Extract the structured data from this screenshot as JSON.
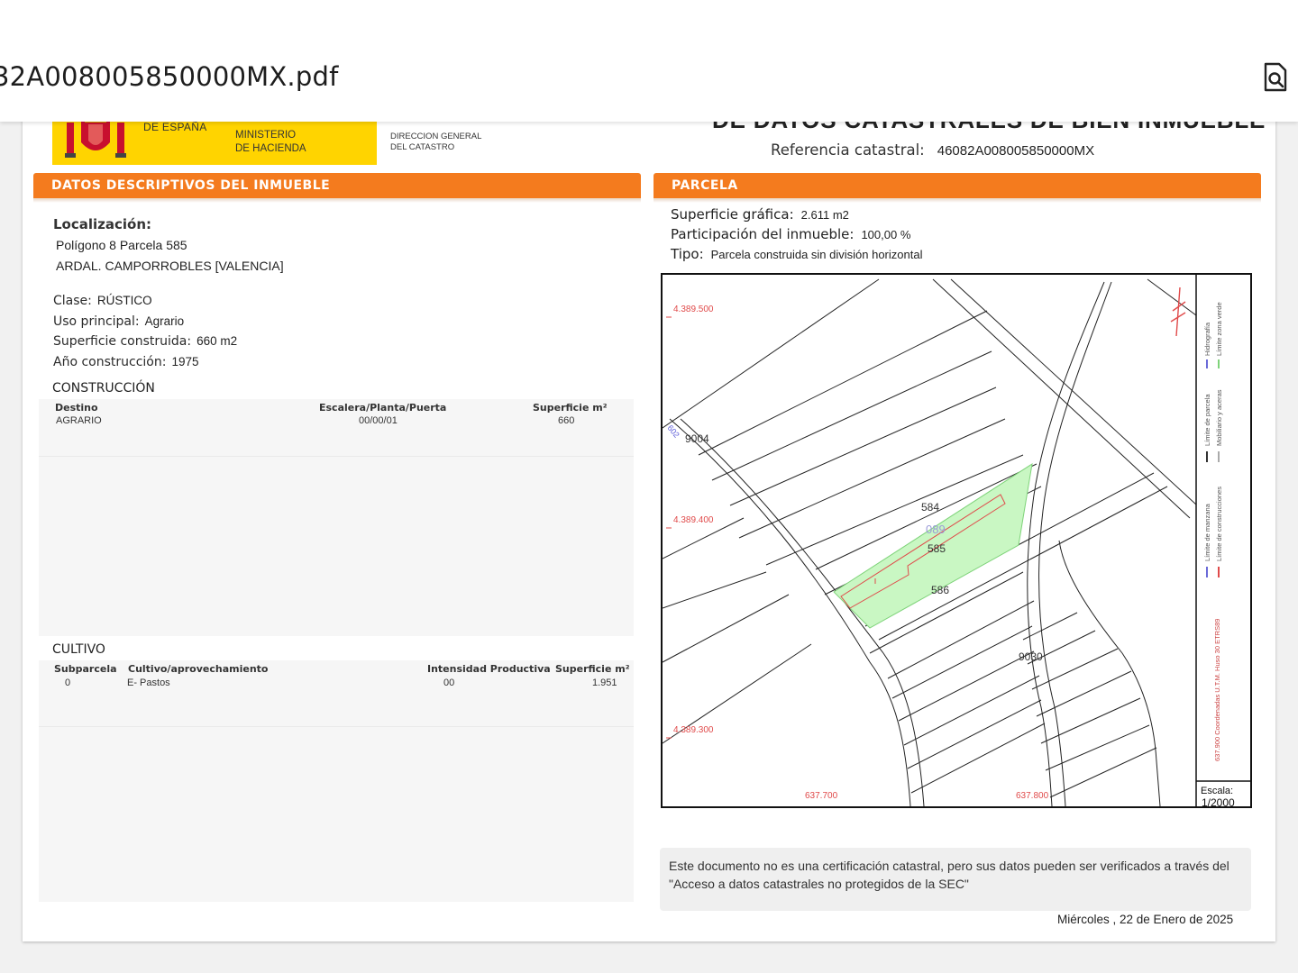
{
  "viewer": {
    "file_name": "32A008005850000MX.pdf",
    "search_icon": "document-search-icon"
  },
  "header": {
    "gov_country": "DE ESPAÑA",
    "ministry_line1": "MINISTERIO",
    "ministry_line2": "DE HACIENDA",
    "dgc_line1": "DIRECCION GENERAL",
    "dgc_line2": "DEL CATASTRO",
    "doc_title": "DE DATOS CATASTRALES DE BIEN INMUEBLE",
    "ref_label": "Referencia catastral:",
    "ref_value": "46082A008005850000MX",
    "brand_color": "#ffd400",
    "accent_color": "#f47b1e"
  },
  "left": {
    "title": "DATOS DESCRIPTIVOS DEL INMUEBLE",
    "loc_label": "Localización:",
    "loc_line1": "Polígono 8 Parcela 585",
    "loc_line2": "ARDAL. CAMPORROBLES [VALENCIA]",
    "clase_label": "Clase:",
    "clase_value": "RÚSTICO",
    "uso_label": "Uso principal:",
    "uso_value": "Agrario",
    "sup_label": "Superficie construida:",
    "sup_value": "660 m2",
    "anio_label": "Año construcción:",
    "anio_value": "1975",
    "construccion": {
      "title": "CONSTRUCCIÓN",
      "headers": [
        "Destino",
        "Escalera/Planta/Puerta",
        "Superficie m²"
      ],
      "row": [
        "AGRARIO",
        "00/00/01",
        "660"
      ]
    },
    "cultivo": {
      "title": "CULTIVO",
      "headers": [
        "Subparcela",
        "Cultivo/aprovechamiento",
        "Intensidad Productiva",
        "Superficie m²"
      ],
      "row": [
        "0",
        "E- Pastos",
        "00",
        "1.951"
      ]
    }
  },
  "right": {
    "title": "PARCELA",
    "sup_label": "Superficie gráfica:",
    "sup_value": "2.611 m2",
    "part_label": "Participación del inmueble:",
    "part_value": "100,00 %",
    "tipo_label": "Tipo:",
    "tipo_value": "Parcela construida sin división horizontal",
    "map": {
      "coord_labels": [
        "4.389.500",
        "4.389.400",
        "4.389.300",
        "637.700",
        "637.800"
      ],
      "parcel_labels": [
        "584",
        "585",
        "586",
        "9004",
        "9030",
        "089",
        "602"
      ],
      "legend": [
        "Límite de manzana",
        "Límite de parcela",
        "Hidrografía",
        "Límite de construcciones",
        "Mobiliario y aceras",
        "Límite zona verde"
      ],
      "projection": "637.900 Coordenadas U.T.M. Huso 30 ETRS89",
      "scale_label": "Escala:",
      "scale_value": "1/2000",
      "parcel_fill": "#c9f7c3"
    },
    "note": "Este documento no es una certificación catastral, pero sus datos pueden ser verificados a través del \"Acceso a datos catastrales no protegidos de la SEC\"",
    "date": "Miércoles , 22 de Enero de 2025"
  }
}
